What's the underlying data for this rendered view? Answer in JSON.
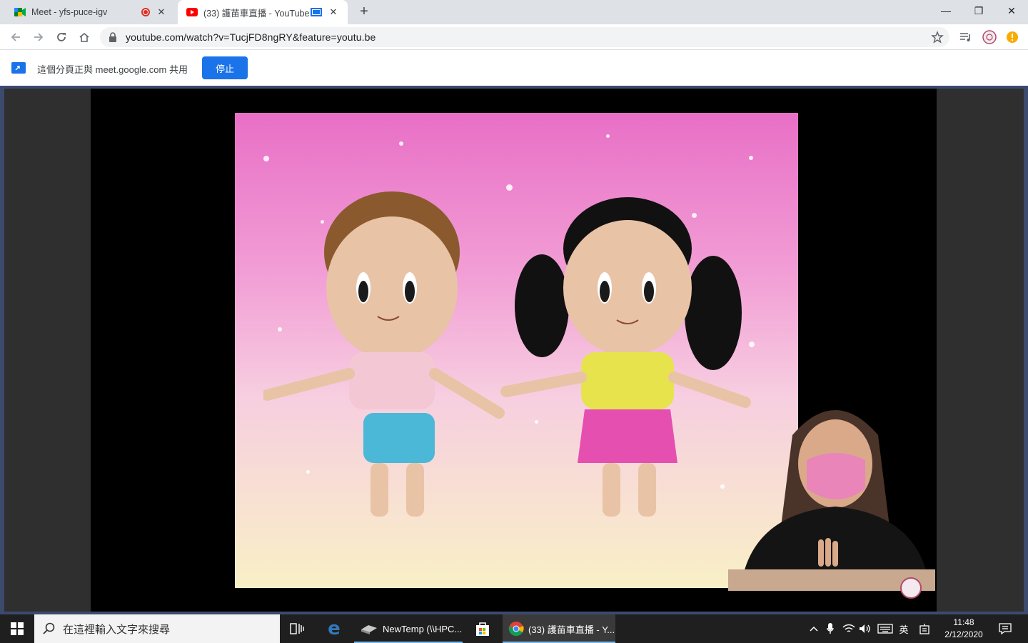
{
  "browser": {
    "tabs": [
      {
        "title": "Meet - yfs-puce-igv",
        "favicon": "google-meet-icon",
        "recording": true
      },
      {
        "title": "(33) 護苗車直播 - YouTube",
        "favicon": "youtube-icon",
        "casting": true
      }
    ],
    "url": "youtube.com/watch?v=TucjFD8ngRY&feature=youtu.be"
  },
  "sharebar": {
    "message": "這個分頁正與 meet.google.com 共用",
    "stop_label": "停止"
  },
  "taskbar": {
    "search_placeholder": "在這裡輸入文字來搜尋",
    "apps": [
      {
        "label": "NewTemp (\\\\HPC...",
        "icon": "folder-icon"
      },
      {
        "label": "(33) 護苗車直播 - Y...",
        "icon": "chrome-icon"
      }
    ],
    "ime": "英",
    "time": "11:48",
    "date": "2/12/2020"
  },
  "colors": {
    "accent": "#1a73e8",
    "taskbar": "#1f1f1f",
    "page_border": "#3c4a6e"
  }
}
